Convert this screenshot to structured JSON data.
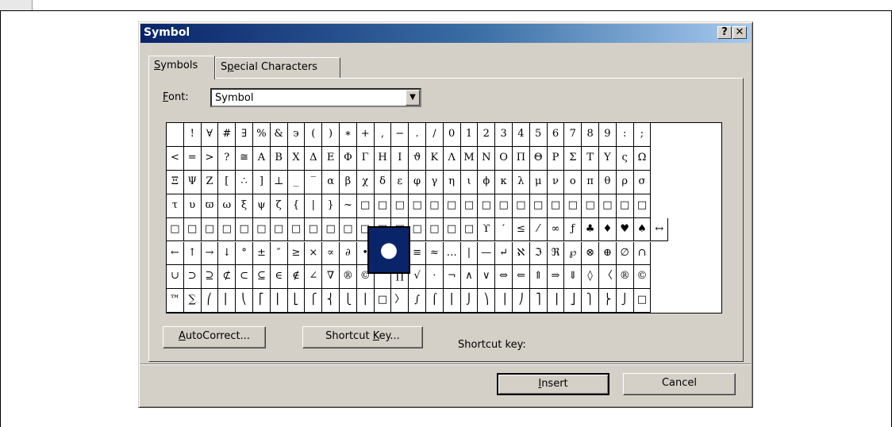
{
  "dialog": {
    "title": "Symbol",
    "help_glyph": "?",
    "close_glyph": "✕"
  },
  "tabs": [
    {
      "pre": "",
      "u": "S",
      "post": "ymbols",
      "active": true
    },
    {
      "pre": "S",
      "u": "p",
      "post": "ecial Characters",
      "active": false
    }
  ],
  "font": {
    "label_u": "F",
    "label_post": "ont:",
    "value": "Symbol",
    "dropdown_glyph": "▼"
  },
  "grid": {
    "columns": 32,
    "rows": [
      [
        " ",
        "!",
        "∀",
        "#",
        "∃",
        "%",
        "&",
        "϶",
        "(",
        ")",
        "∗",
        "+",
        ",",
        "−",
        ".",
        "/",
        "0",
        "1",
        "2",
        "3",
        "4",
        "5",
        "6",
        "7",
        "8",
        "9",
        ":",
        ";"
      ],
      [
        "<",
        "=",
        ">",
        "?",
        "≅",
        "Α",
        "Β",
        "Χ",
        "Δ",
        "Ε",
        "Φ",
        "Γ",
        "Η",
        "Ι",
        "ϑ",
        "Κ",
        "Λ",
        "Μ",
        "Ν",
        "Ο",
        "Π",
        "Θ",
        "Ρ",
        "Σ",
        "Τ",
        "Υ",
        "ς",
        "Ω"
      ],
      [
        "Ξ",
        "Ψ",
        "Ζ",
        "[",
        "∴",
        "]",
        "⊥",
        "_",
        "‾",
        "α",
        "β",
        "χ",
        "δ",
        "ε",
        "φ",
        "γ",
        "η",
        "ι",
        "ϕ",
        "κ",
        "λ",
        "μ",
        "ν",
        "ο",
        "π",
        "θ",
        "ρ",
        "σ"
      ],
      [
        "τ",
        "υ",
        "ϖ",
        "ω",
        "ξ",
        "ψ",
        "ζ",
        "{",
        "|",
        "}",
        "~",
        "□",
        "□",
        "□",
        "□",
        "□",
        "□",
        "□",
        "□",
        "□",
        "□",
        "□",
        "□",
        "□",
        "□",
        "□",
        "□",
        "□"
      ],
      [
        "□",
        "□",
        "□",
        "□",
        "□",
        "□",
        "□",
        "□",
        "□",
        "□",
        "□",
        "□",
        "□",
        "□",
        "□",
        "□",
        "□",
        "□",
        "ϒ",
        "′",
        "≤",
        "⁄",
        "∞",
        "ƒ",
        "♣",
        "♦",
        "♥",
        "♠",
        "↔"
      ],
      [
        "←",
        "↑",
        "→",
        "↓",
        "°",
        "±",
        "″",
        "≥",
        "×",
        "∝",
        "∂",
        "•",
        "÷",
        "≠",
        "≡",
        "≈",
        "…",
        "|",
        "—",
        "↵",
        "ℵ",
        "ℑ",
        "ℜ",
        "℘",
        "⊗",
        "⊕",
        "∅",
        "∩"
      ],
      [
        "∪",
        "⊃",
        "⊇",
        "⊄",
        "⊂",
        "⊆",
        "∈",
        "∉",
        "∠",
        "∇",
        "®",
        "©",
        "™",
        "∏",
        "√",
        "⋅",
        "¬",
        "∧",
        "∨",
        "⇔",
        "⇐",
        "⇑",
        "⇒",
        "⇓",
        "◊",
        "〈",
        "®",
        "©"
      ],
      [
        "™",
        "∑",
        "⎛",
        "⎜",
        "⎝",
        "⎡",
        "⎢",
        "⎣",
        "⎧",
        "⎨",
        "⎩",
        "⎪",
        "□",
        "〉",
        "∫",
        "⌠",
        "⎮",
        "⌡",
        "⎞",
        "⎟",
        "⎠",
        "⎤",
        "⎥",
        "⎦",
        "⎫",
        "⎬",
        "⎭",
        "□"
      ]
    ],
    "selected_glyph": "●"
  },
  "buttons": {
    "autocorrect": {
      "pre": "",
      "u": "A",
      "post": "utoCorrect..."
    },
    "shortcut_key": {
      "pre": "Shortcut ",
      "u": "K",
      "post": "ey..."
    },
    "insert": {
      "pre": "",
      "u": "I",
      "post": "nsert"
    },
    "cancel": "Cancel"
  },
  "shortcut_label": "Shortcut key:"
}
